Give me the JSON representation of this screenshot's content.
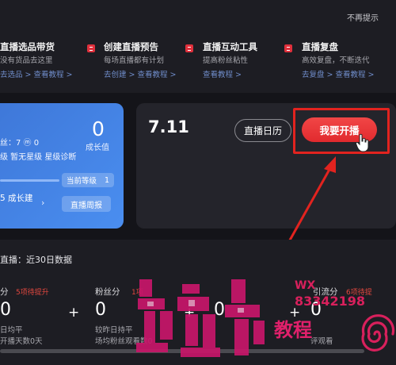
{
  "tips": {
    "dismiss_label": "不再提示",
    "items": [
      {
        "title": "直播选品带货",
        "desc": "没有货品去这里",
        "links": "去选品 > 查看教程 >"
      },
      {
        "title": "创建直播预告",
        "desc": "每场直播都有计划",
        "links": "去创建 > 查看教程 >"
      },
      {
        "title": "直播互动工具",
        "desc": "提高粉丝粘性",
        "links": "查看教程 >"
      },
      {
        "title": "直播复盘",
        "desc": "高效复盘，不断迭代",
        "links": "去复盘 > 查看教程 >"
      }
    ]
  },
  "growth": {
    "value": "0",
    "value_label": "成长值",
    "fans_line": "丝：7  ⓜ 0",
    "stars_line": "级  暂无星级  星级诊断",
    "current_level_label": "当前等级",
    "current_level_value": "1",
    "build_text": "5 成长建",
    "weekly_report_label": "直播周报"
  },
  "live": {
    "date": "7.11",
    "calendar_label": "直播日历",
    "start_label": "我要开播"
  },
  "data_panel": {
    "title": "直播：近30日数据",
    "metrics": [
      {
        "label": "分",
        "badge": "5项待提升",
        "value": "0",
        "sub1": "日均平",
        "sub2": "开播天数0天"
      },
      {
        "label": "粉丝分",
        "badge": "1项",
        "value": "0",
        "sub1": "较昨日持平",
        "sub2": "场均粉丝观看数0"
      },
      {
        "label": "",
        "badge": "",
        "value": "0",
        "sub1": "",
        "sub2": ""
      },
      {
        "label": "引流分",
        "badge": "6项待提",
        "value": "0",
        "sub1": "",
        "sub2": "评观看"
      }
    ]
  },
  "watermark": {
    "wx": "WX",
    "number": "83342198",
    "text": "教程"
  },
  "colors": {
    "accent_red": "#e2231f",
    "growth_blue": "#4a8ef0",
    "card_dark": "#24242b"
  },
  "icons": [
    "tip-icon",
    "hand-cursor-icon",
    "swirl-icon"
  ]
}
